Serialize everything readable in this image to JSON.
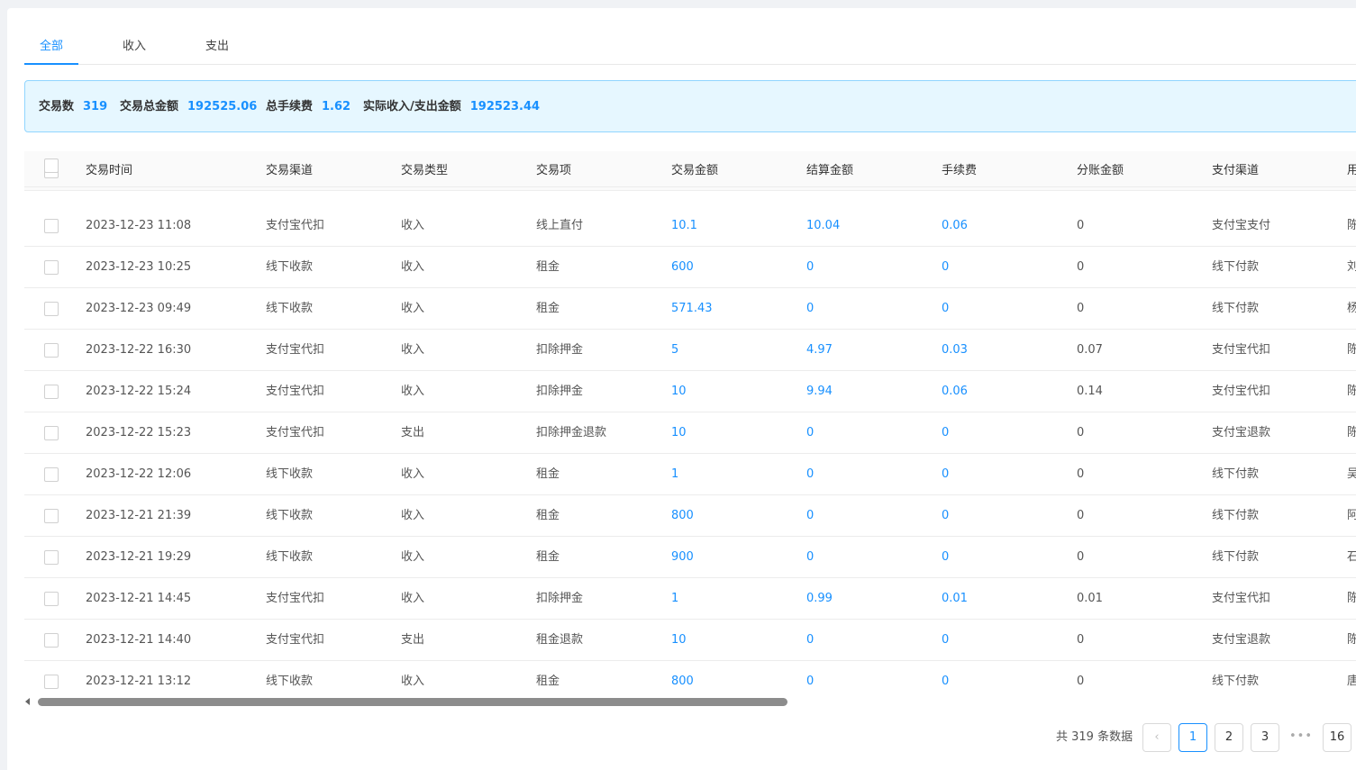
{
  "tabs": [
    {
      "label": "全部",
      "active": true
    },
    {
      "label": "收入",
      "active": false
    },
    {
      "label": "支出",
      "active": false
    }
  ],
  "summary": {
    "count_label": "交易数",
    "count_value": "319",
    "total_label": "交易总金额",
    "total_value": "192525.06",
    "fee_label": "总手续费",
    "fee_value": "1.62",
    "actual_label": "实际收入/支出金额",
    "actual_value": "192523.44"
  },
  "table": {
    "headers": [
      "交易时间",
      "交易渠道",
      "交易类型",
      "交易项",
      "交易金额",
      "结算金额",
      "手续费",
      "分账金额",
      "支付渠道",
      "用"
    ],
    "rows": [
      [
        "2023-12-23 11:08",
        "支付宝代扣",
        "收入",
        "线上直付",
        "10.1",
        "10.04",
        "0.06",
        "0",
        "支付宝支付",
        "陈"
      ],
      [
        "2023-12-23 10:25",
        "线下收款",
        "收入",
        "租金",
        "600",
        "0",
        "0",
        "0",
        "线下付款",
        "刘"
      ],
      [
        "2023-12-23 09:49",
        "线下收款",
        "收入",
        "租金",
        "571.43",
        "0",
        "0",
        "0",
        "线下付款",
        "杨"
      ],
      [
        "2023-12-22 16:30",
        "支付宝代扣",
        "收入",
        "扣除押金",
        "5",
        "4.97",
        "0.03",
        "0.07",
        "支付宝代扣",
        "陈"
      ],
      [
        "2023-12-22 15:24",
        "支付宝代扣",
        "收入",
        "扣除押金",
        "10",
        "9.94",
        "0.06",
        "0.14",
        "支付宝代扣",
        "陈"
      ],
      [
        "2023-12-22 15:23",
        "支付宝代扣",
        "支出",
        "扣除押金退款",
        "10",
        "0",
        "0",
        "0",
        "支付宝退款",
        "陈"
      ],
      [
        "2023-12-22 12:06",
        "线下收款",
        "收入",
        "租金",
        "1",
        "0",
        "0",
        "0",
        "线下付款",
        "吴"
      ],
      [
        "2023-12-21 21:39",
        "线下收款",
        "收入",
        "租金",
        "800",
        "0",
        "0",
        "0",
        "线下付款",
        "阿"
      ],
      [
        "2023-12-21 19:29",
        "线下收款",
        "收入",
        "租金",
        "900",
        "0",
        "0",
        "0",
        "线下付款",
        "石"
      ],
      [
        "2023-12-21 14:45",
        "支付宝代扣",
        "收入",
        "扣除押金",
        "1",
        "0.99",
        "0.01",
        "0.01",
        "支付宝代扣",
        "陈"
      ],
      [
        "2023-12-21 14:40",
        "支付宝代扣",
        "支出",
        "租金退款",
        "10",
        "0",
        "0",
        "0",
        "支付宝退款",
        "陈"
      ],
      [
        "2023-12-21 13:12",
        "线下收款",
        "收入",
        "租金",
        "800",
        "0",
        "0",
        "0",
        "线下付款",
        "唐"
      ]
    ]
  },
  "pagination": {
    "total_text": "共 319 条数据",
    "prev_icon": "chevron-left-icon",
    "pages": [
      "1",
      "2",
      "3"
    ],
    "current": "1",
    "ellipsis": "•••",
    "last": "16"
  },
  "colors": {
    "accent": "#1890ff",
    "summary_bg": "#e6f7ff",
    "summary_border": "#91d5ff"
  }
}
